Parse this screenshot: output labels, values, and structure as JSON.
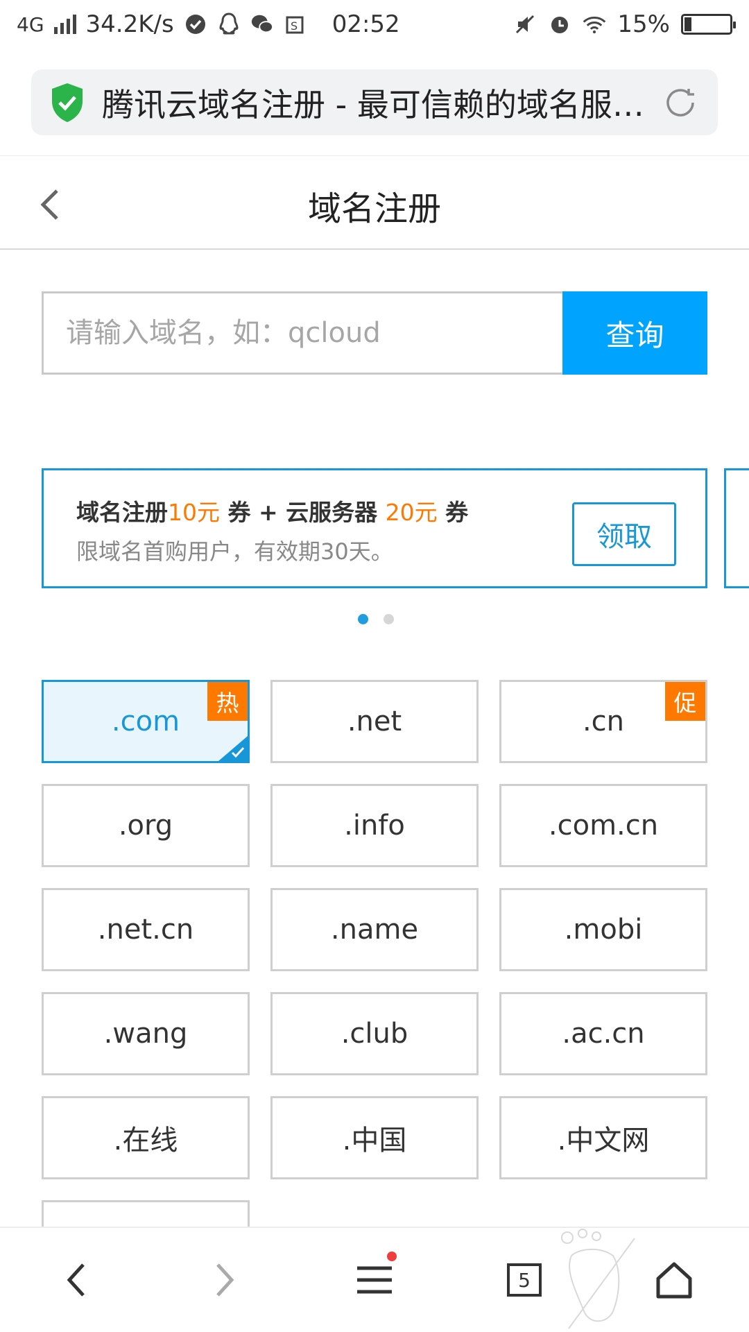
{
  "status_bar": {
    "network": "4G",
    "speed": "34.2K/s",
    "time": "02:52",
    "battery": "15%",
    "battery_level": 0.15
  },
  "browser": {
    "page_title": "腾讯云域名注册 - 最可信赖的域名服务商"
  },
  "header": {
    "title": "域名注册"
  },
  "search": {
    "placeholder": "请输入域名，如：qcloud",
    "button_label": "查询"
  },
  "promo": {
    "line1": {
      "part1": "域名注册",
      "amount1": "10元",
      "part2": " 券 + 云服务器 ",
      "amount2": "20元",
      "part3": " 券"
    },
    "line2": "限域名首购用户，有效期30天。",
    "claim_label": "领取",
    "page_count": 2,
    "active_page": 1
  },
  "domains": [
    {
      "label": ".com",
      "badge": "热",
      "selected": true
    },
    {
      "label": ".net",
      "badge": "",
      "selected": false
    },
    {
      "label": ".cn",
      "badge": "促",
      "selected": false
    },
    {
      "label": ".org",
      "badge": "",
      "selected": false
    },
    {
      "label": ".info",
      "badge": "",
      "selected": false
    },
    {
      "label": ".com.cn",
      "badge": "",
      "selected": false
    },
    {
      "label": ".net.cn",
      "badge": "",
      "selected": false
    },
    {
      "label": ".name",
      "badge": "",
      "selected": false
    },
    {
      "label": ".mobi",
      "badge": "",
      "selected": false
    },
    {
      "label": ".wang",
      "badge": "",
      "selected": false
    },
    {
      "label": ".club",
      "badge": "",
      "selected": false
    },
    {
      "label": ".ac.cn",
      "badge": "",
      "selected": false
    },
    {
      "label": ".在线",
      "badge": "",
      "selected": false
    },
    {
      "label": ".中国",
      "badge": "",
      "selected": false
    },
    {
      "label": ".中文网",
      "badge": "",
      "selected": false
    }
  ],
  "bottom_nav": {
    "tab_count": "5"
  },
  "colors": {
    "accent": "#00a4ff",
    "promo_border": "#1797d8",
    "highlight": "#ff7800",
    "shield": "#2bb44a"
  }
}
